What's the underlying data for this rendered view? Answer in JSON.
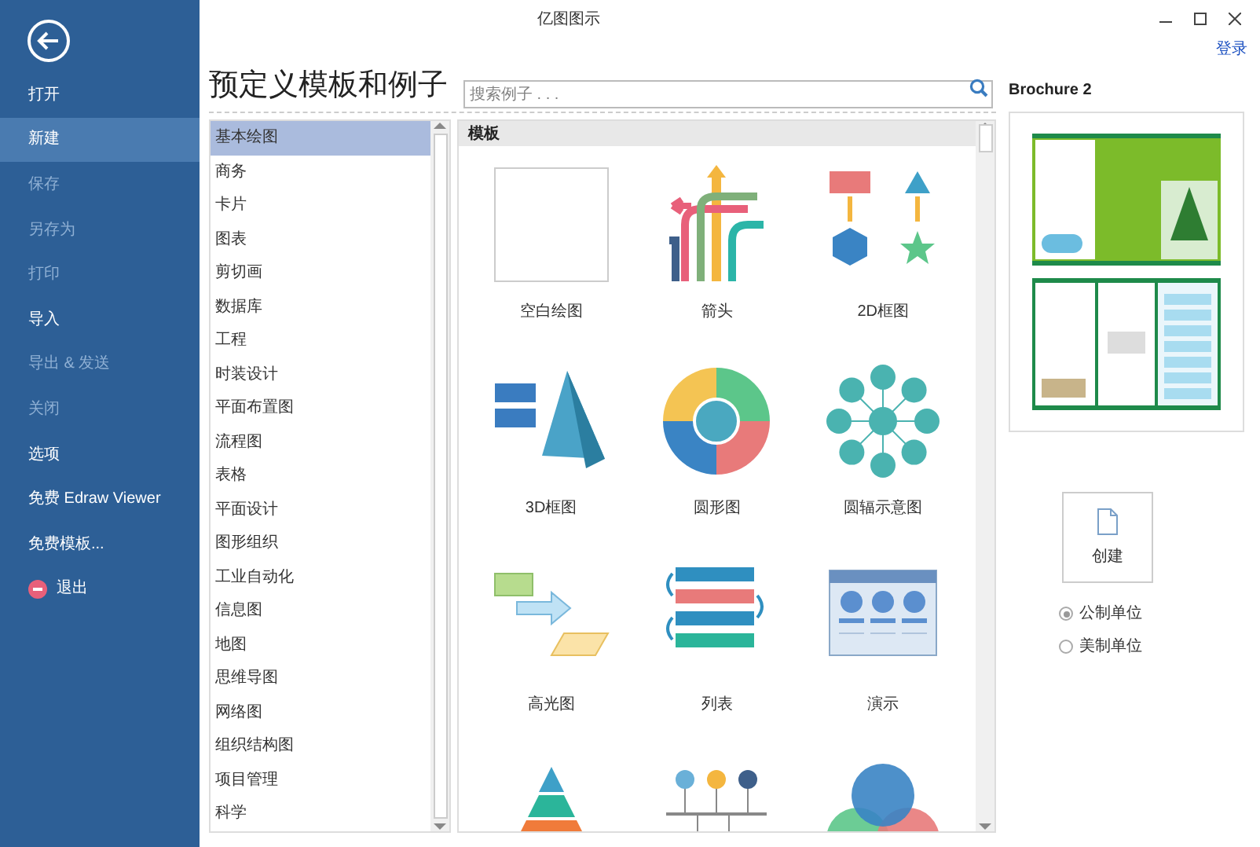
{
  "window": {
    "title": "亿图图示"
  },
  "login": "登录",
  "sidebar": {
    "items": [
      {
        "label": "打开",
        "selected": false,
        "disabled": false,
        "kind": "plain"
      },
      {
        "label": "新建",
        "selected": true,
        "disabled": false,
        "kind": "plain"
      },
      {
        "label": "保存",
        "selected": false,
        "disabled": true,
        "kind": "plain"
      },
      {
        "label": "另存为",
        "selected": false,
        "disabled": true,
        "kind": "plain"
      },
      {
        "label": "打印",
        "selected": false,
        "disabled": true,
        "kind": "plain"
      },
      {
        "label": "导入",
        "selected": false,
        "disabled": false,
        "kind": "plain"
      },
      {
        "label": "导出 & 发送",
        "selected": false,
        "disabled": true,
        "kind": "plain"
      },
      {
        "label": "关闭",
        "selected": false,
        "disabled": true,
        "kind": "plain"
      },
      {
        "label": "选项",
        "selected": false,
        "disabled": false,
        "kind": "plain"
      },
      {
        "label": "免费 Edraw Viewer",
        "selected": false,
        "disabled": false,
        "kind": "plain"
      },
      {
        "label": "免费模板...",
        "selected": false,
        "disabled": false,
        "kind": "plain"
      },
      {
        "label": "退出",
        "selected": false,
        "disabled": false,
        "kind": "exit"
      }
    ]
  },
  "heading": "预定义模板和例子",
  "search": {
    "placeholder": "搜索例子 . . ."
  },
  "categories": [
    {
      "label": "基本绘图",
      "selected": true
    },
    {
      "label": "商务",
      "selected": false
    },
    {
      "label": "卡片",
      "selected": false
    },
    {
      "label": "图表",
      "selected": false
    },
    {
      "label": "剪切画",
      "selected": false
    },
    {
      "label": "数据库",
      "selected": false
    },
    {
      "label": "工程",
      "selected": false
    },
    {
      "label": "时装设计",
      "selected": false
    },
    {
      "label": "平面布置图",
      "selected": false
    },
    {
      "label": "流程图",
      "selected": false
    },
    {
      "label": "表格",
      "selected": false
    },
    {
      "label": "平面设计",
      "selected": false
    },
    {
      "label": "图形组织",
      "selected": false
    },
    {
      "label": "工业自动化",
      "selected": false
    },
    {
      "label": "信息图",
      "selected": false
    },
    {
      "label": "地图",
      "selected": false
    },
    {
      "label": "思维导图",
      "selected": false
    },
    {
      "label": "网络图",
      "selected": false
    },
    {
      "label": "组织结构图",
      "selected": false
    },
    {
      "label": "项目管理",
      "selected": false
    },
    {
      "label": "科学",
      "selected": false
    }
  ],
  "templates": {
    "section": "模板",
    "items": [
      {
        "label": "空白绘图",
        "kind": "blank"
      },
      {
        "label": "箭头",
        "kind": "arrows"
      },
      {
        "label": "2D框图",
        "kind": "block2d"
      },
      {
        "label": "3D框图",
        "kind": "block3d"
      },
      {
        "label": "圆形图",
        "kind": "circle"
      },
      {
        "label": "圆辐示意图",
        "kind": "radial"
      },
      {
        "label": "高光图",
        "kind": "highlight"
      },
      {
        "label": "列表",
        "kind": "list"
      },
      {
        "label": "演示",
        "kind": "presentation"
      },
      {
        "kind": "pyramid"
      },
      {
        "kind": "timeline"
      },
      {
        "kind": "venn"
      }
    ]
  },
  "preview": {
    "title": "Brochure 2",
    "create": "创建",
    "units": [
      {
        "label": "公制单位",
        "selected": true
      },
      {
        "label": "美制单位",
        "selected": false
      }
    ]
  }
}
